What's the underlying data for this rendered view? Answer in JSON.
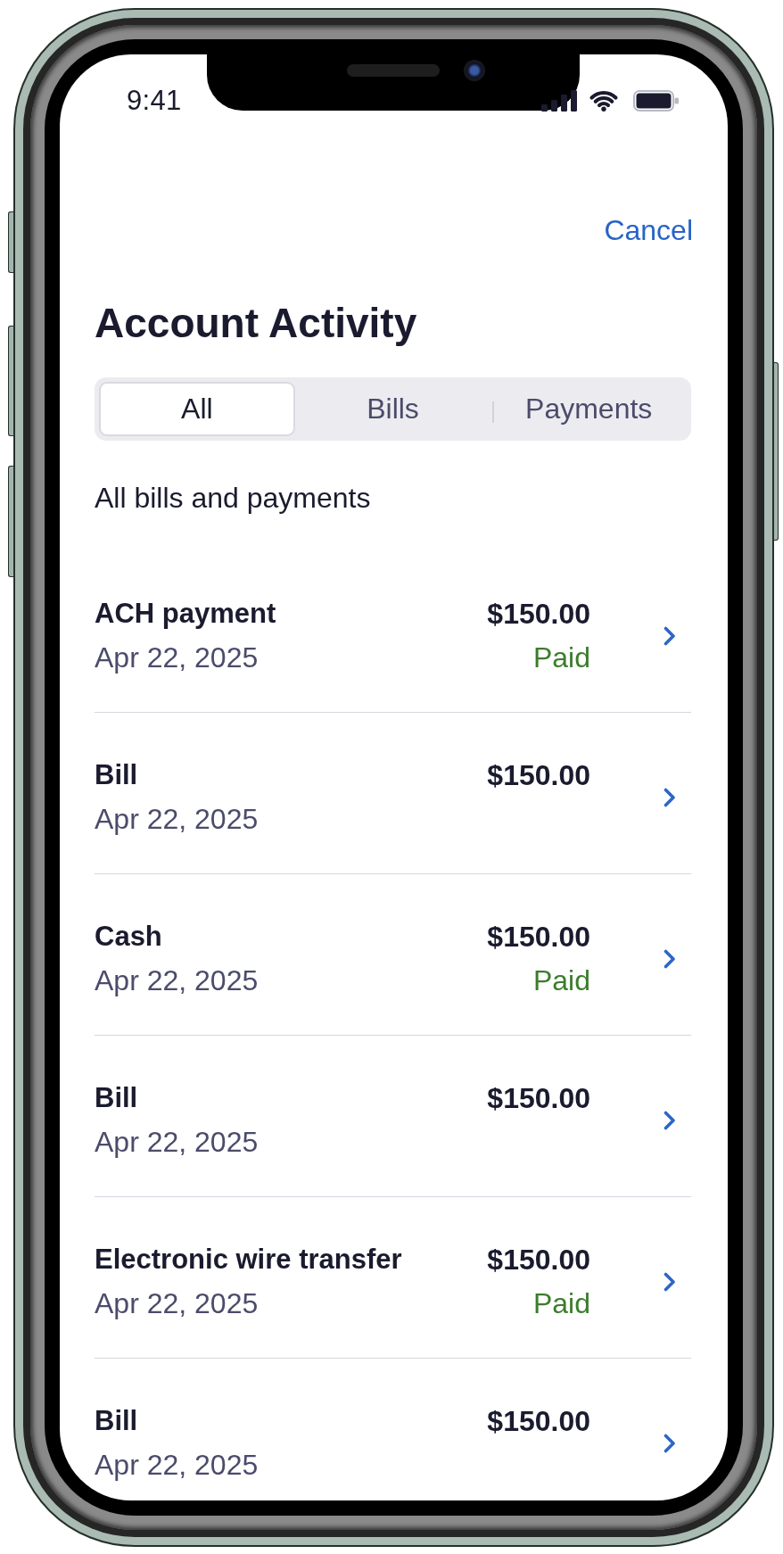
{
  "status_bar": {
    "time": "9:41"
  },
  "nav": {
    "cancel": "Cancel"
  },
  "title": "Account Activity",
  "tabs": [
    {
      "label": "All",
      "selected": true
    },
    {
      "label": "Bills",
      "selected": false
    },
    {
      "label": "Payments",
      "selected": false
    }
  ],
  "subtitle": "All bills and payments",
  "transactions": [
    {
      "title": "ACH payment",
      "date": "Apr 22, 2025",
      "amount": "$150.00",
      "status": "Paid"
    },
    {
      "title": "Bill",
      "date": "Apr 22, 2025",
      "amount": "$150.00"
    },
    {
      "title": "Cash",
      "date": "Apr 22, 2025",
      "amount": "$150.00",
      "status": "Paid"
    },
    {
      "title": "Bill",
      "date": "Apr 22, 2025",
      "amount": "$150.00"
    },
    {
      "title": "Electronic wire transfer",
      "date": "Apr 22, 2025",
      "amount": "$150.00",
      "status": "Paid"
    },
    {
      "title": "Bill",
      "date": "Apr 22, 2025",
      "amount": "$150.00"
    }
  ]
}
